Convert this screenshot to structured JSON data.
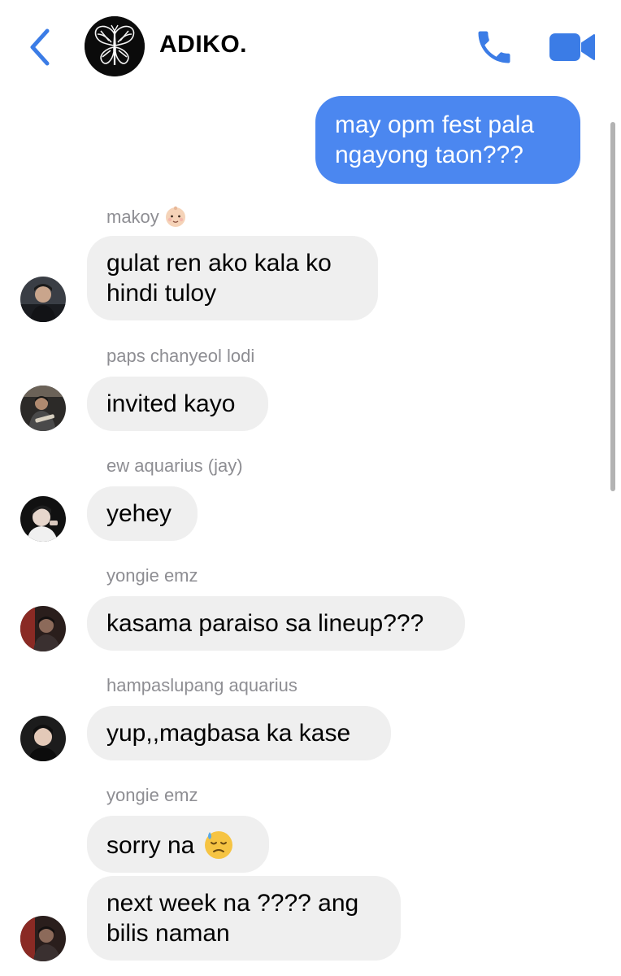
{
  "header": {
    "back_icon": "chevron-left-icon",
    "group_name": "ADIKO.",
    "group_avatar_icon": "butterfly-icon",
    "call_icon": "phone-icon",
    "video_icon": "video-camera-icon",
    "accent_color": "#3b7ce6"
  },
  "messages": [
    {
      "direction": "outgoing",
      "lines": [
        "may opm fest pala",
        "ngayong taon???"
      ]
    },
    {
      "direction": "incoming",
      "sender": "makoy",
      "sender_emoji": "baby-face-emoji",
      "lines": [
        "gulat ren ako kala ko",
        "hindi tuloy"
      ]
    },
    {
      "direction": "incoming",
      "sender": "paps chanyeol lodi",
      "lines": [
        "invited kayo"
      ]
    },
    {
      "direction": "incoming",
      "sender": "ew aquarius (jay)",
      "lines": [
        "yehey"
      ]
    },
    {
      "direction": "incoming",
      "sender": "yongie emz",
      "lines": [
        "kasama paraiso sa lineup???"
      ]
    },
    {
      "direction": "incoming",
      "sender": "hampaslupang aquarius",
      "lines": [
        "yup,,magbasa ka kase"
      ]
    },
    {
      "direction": "incoming",
      "sender": "yongie emz",
      "lines": [
        "sorry na"
      ],
      "trailing_emoji": "downcast-face-with-sweat-emoji"
    },
    {
      "direction": "incoming",
      "lines": [
        "next week na ???? ang",
        "bilis naman"
      ]
    }
  ],
  "colors": {
    "outgoing_bubble": "#4b87f0",
    "incoming_bubble": "#efefef",
    "sender_name": "#8e8e93"
  }
}
